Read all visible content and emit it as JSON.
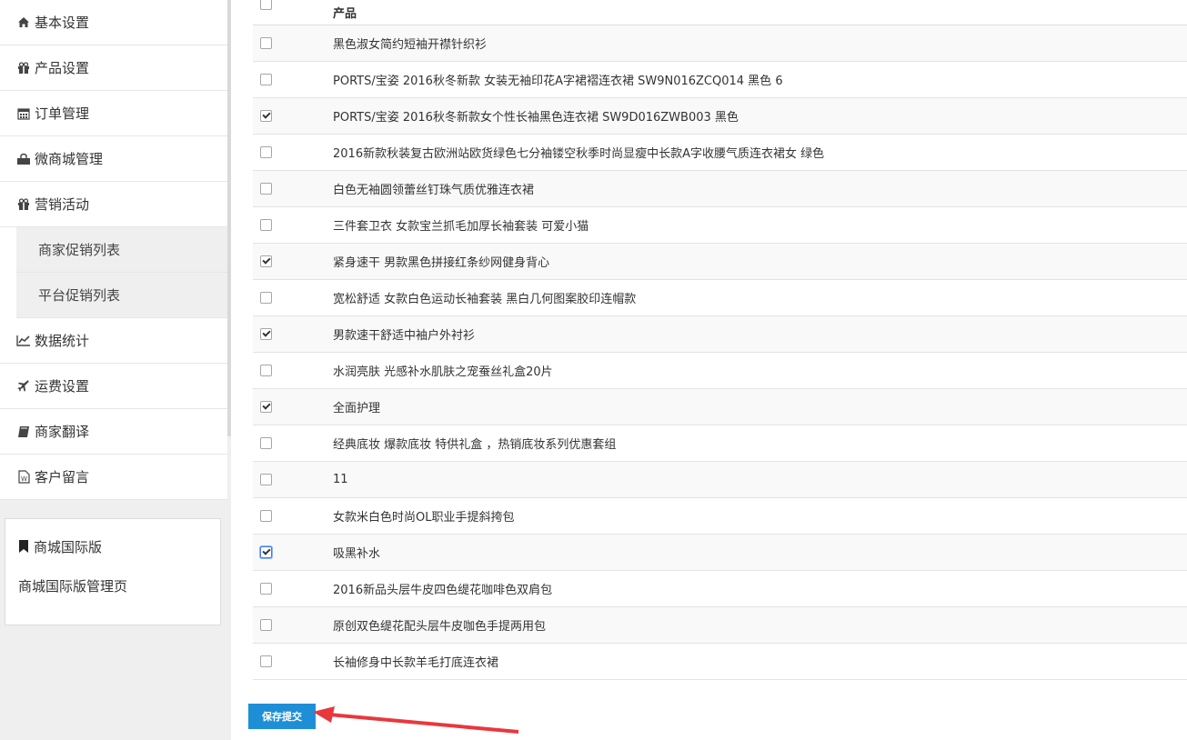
{
  "sidebar": {
    "items": [
      {
        "label": "基本设置",
        "icon": "home-icon"
      },
      {
        "label": "产品设置",
        "icon": "gift-icon"
      },
      {
        "label": "订单管理",
        "icon": "calendar-icon"
      },
      {
        "label": "微商城管理",
        "icon": "shop-icon"
      },
      {
        "label": "营销活动",
        "icon": "gift-icon"
      }
    ],
    "sub_items": [
      {
        "label": "商家促销列表"
      },
      {
        "label": "平台促销列表"
      }
    ],
    "items_after": [
      {
        "label": "数据统计",
        "icon": "chart-line-icon"
      },
      {
        "label": "运费设置",
        "icon": "plane-icon"
      },
      {
        "label": "商家翻译",
        "icon": "book-icon"
      },
      {
        "label": "客户留言",
        "icon": "document-icon"
      }
    ],
    "card": {
      "title": "商城国际版",
      "link": "商城国际版管理页"
    }
  },
  "table": {
    "header": "产品",
    "rows": [
      {
        "name": "黑色淑女简约短袖开襟针织衫",
        "checked": false
      },
      {
        "name": "PORTS/宝姿 2016秋冬新款 女装无袖印花A字裙褶连衣裙 SW9N016ZCQ014 黑色 6",
        "checked": false
      },
      {
        "name": "PORTS/宝姿 2016秋冬新款女个性长袖黑色连衣裙 SW9D016ZWB003 黑色",
        "checked": true
      },
      {
        "name": "2016新款秋装复古欧洲站欧货绿色七分袖镂空秋季时尚显瘦中长款A字收腰气质连衣裙女 绿色",
        "checked": false
      },
      {
        "name": "白色无袖圆领蕾丝钉珠气质优雅连衣裙",
        "checked": false
      },
      {
        "name": "三件套卫衣 女款宝兰抓毛加厚长袖套装 可爱小猫",
        "checked": false
      },
      {
        "name": "紧身速干 男款黑色拼接红条纱网健身背心",
        "checked": true
      },
      {
        "name": "宽松舒适 女款白色运动长袖套装 黑白几何图案胶印连帽款",
        "checked": false
      },
      {
        "name": "男款速干舒适中袖户外衬衫",
        "checked": true
      },
      {
        "name": "水润亮肤 光感补水肌肤之宠蚕丝礼盒20片",
        "checked": false
      },
      {
        "name": "全面护理",
        "checked": true
      },
      {
        "name": "经典底妆 爆款底妆 特供礼盒 ，热销底妆系列优惠套组",
        "checked": false
      },
      {
        "name": "11",
        "checked": false
      },
      {
        "name": "女款米白色时尚OL职业手提斜挎包",
        "checked": false
      },
      {
        "name": "吸黑补水",
        "checked": true,
        "focused": true
      },
      {
        "name": "2016新品头层牛皮四色缇花咖啡色双肩包",
        "checked": false
      },
      {
        "name": "原创双色缇花配头层牛皮咖色手提两用包",
        "checked": false
      },
      {
        "name": "长袖修身中长款羊毛打底连衣裙",
        "checked": false
      }
    ]
  },
  "submit_label": "保存提交",
  "colors": {
    "accent": "#1e8fd6",
    "arrow": "#e8383d"
  }
}
